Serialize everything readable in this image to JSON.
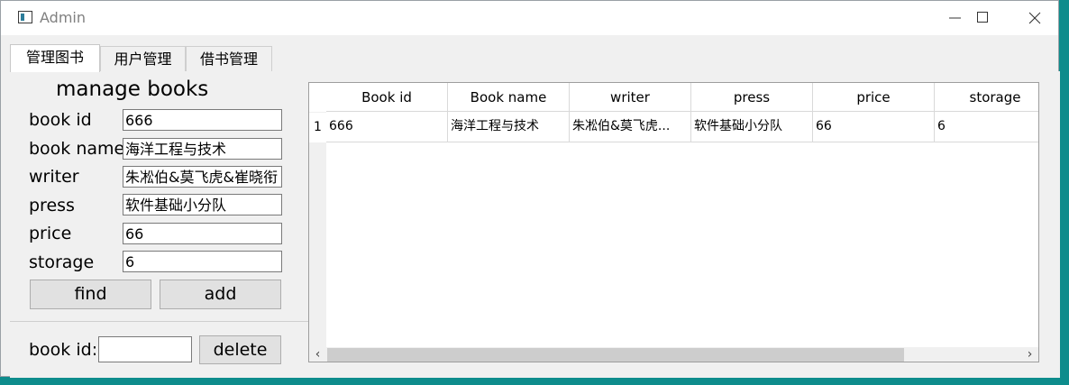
{
  "window": {
    "title": "Admin"
  },
  "tabs": [
    "管理图书",
    "用户管理",
    "借书管理"
  ],
  "form": {
    "heading": "manage books",
    "fields": [
      {
        "label": "book id",
        "value": "666"
      },
      {
        "label": "book name",
        "value": "海洋工程与技术"
      },
      {
        "label": "writer",
        "value": "朱凇伯&莫飞虎&崔晓衔"
      },
      {
        "label": "press",
        "value": "软件基础小分队"
      },
      {
        "label": "price",
        "value": "66"
      },
      {
        "label": "storage",
        "value": "6"
      }
    ],
    "find_label": "find",
    "add_label": "add"
  },
  "delete_section": {
    "label": "book id:",
    "input_value": "",
    "button_label": "delete"
  },
  "table": {
    "columns": [
      "Book id",
      "Book name",
      "writer",
      "press",
      "price",
      "storage"
    ],
    "rows": [
      {
        "num": "1",
        "cells": [
          "666",
          "海洋工程与技术",
          "朱凇伯&莫飞虎...",
          "软件基础小分队",
          "66",
          "6"
        ]
      }
    ]
  }
}
